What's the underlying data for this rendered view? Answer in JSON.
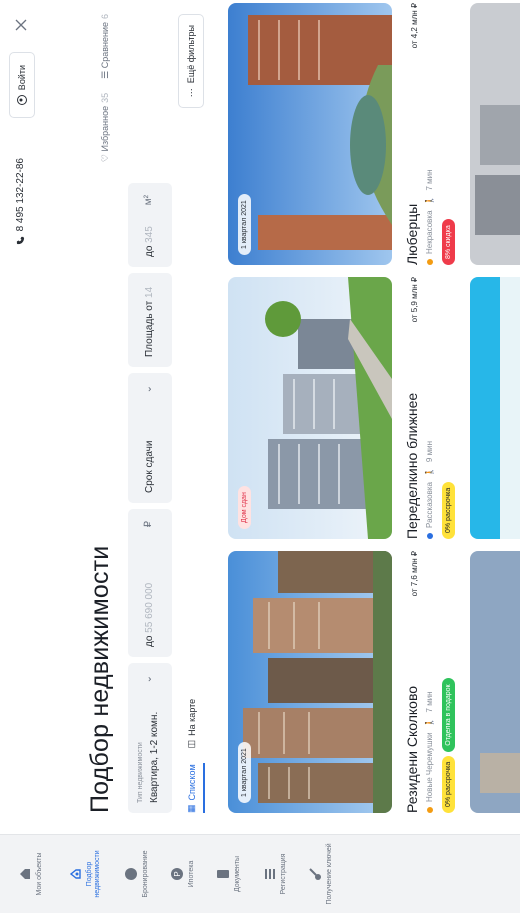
{
  "sidebar": {
    "items": [
      {
        "label": "Мои объекты",
        "icon": "house-icon"
      },
      {
        "label": "Подбор недвижимости",
        "icon": "home-search-icon",
        "active": true
      },
      {
        "label": "Бронирование",
        "icon": "booking-icon"
      },
      {
        "label": "Ипотека",
        "icon": "percent-icon"
      },
      {
        "label": "Документы",
        "icon": "document-icon"
      },
      {
        "label": "Регистрация",
        "icon": "registration-icon"
      },
      {
        "label": "Получение ключей",
        "icon": "key-icon"
      }
    ]
  },
  "header": {
    "phone": "8 495 132-22-86",
    "login_label": "Войти"
  },
  "page": {
    "title": "Подбор недвижимости",
    "favorites_label": "Избранное",
    "favorites_count": "35",
    "compare_label": "Сравнение",
    "compare_count": "6"
  },
  "filters": {
    "property_type_label": "Тип недвижимости",
    "property_type_value": "Квартира, 1-2 комн.",
    "price_prefix": "до",
    "price_value": "55 690 000",
    "price_currency": "₽",
    "deadline_label": "Срок сдачи",
    "area_label": "Площадь от",
    "area_from": "14",
    "area_to_prefix": "до",
    "area_to": "345",
    "area_unit": "м²",
    "more_filters": "Ещё фильтры"
  },
  "view": {
    "list_label": "Списком",
    "map_label": "На карте"
  },
  "cards": [
    {
      "name": "Резидени Сколково",
      "price": "от 7,6 млн ₽",
      "metro": "Новые Черемушки",
      "walk": "7 мин",
      "metro_color": "#f39c12",
      "top_badge": "1 квартал 2021",
      "chips": [
        {
          "text": "0% рассрочка",
          "tone": "yellow"
        },
        {
          "text": "Отделка в подарок",
          "tone": "green"
        }
      ]
    },
    {
      "name": "Переделкино ближнее",
      "price": "от 5,9 млн ₽",
      "metro": "Рассказовка",
      "walk": "9 мин",
      "metro_color": "#2a6fe0",
      "top_badge": "Дом сдан",
      "chips": [
        {
          "text": "0% рассрочка",
          "tone": "yellow"
        }
      ]
    },
    {
      "name": "Люберцы",
      "price": "от 4,2 млн ₽",
      "metro": "Некрасовка",
      "walk": "7 мин",
      "metro_color": "#f39c12",
      "top_badge": "1 квартал 2021",
      "chips": [
        {
          "text": "8% скидка",
          "tone": "red"
        }
      ]
    }
  ],
  "colors": {
    "accent": "#2a6fe0",
    "yellow_chip": "#ffe23a",
    "green_chip": "#2fc35c",
    "red_chip": "#ef3b4a"
  }
}
